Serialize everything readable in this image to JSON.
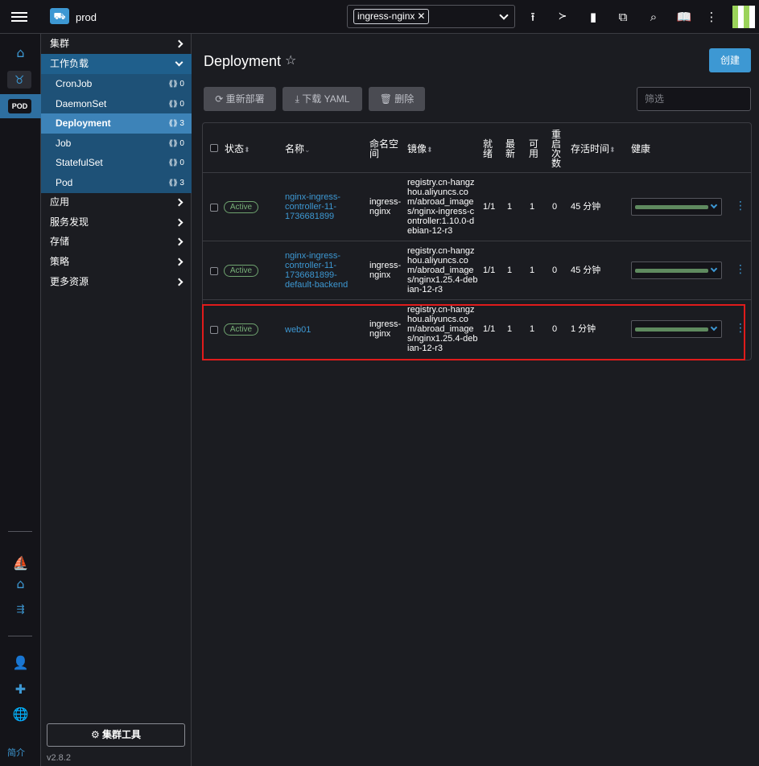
{
  "topbar": {
    "cluster_name": "prod",
    "namespace_chip": "ingress-nginx",
    "chip_remove": "✕",
    "icons": [
      "import-yaml-icon",
      "kubectl-shell-icon",
      "kubeconfig-icon",
      "copy-kubeconfig-icon",
      "search-icon",
      "docs-icon",
      "more-icon"
    ]
  },
  "rail": {
    "pod_label": "POD",
    "about": "简介"
  },
  "nav": {
    "groups": [
      {
        "label": "集群"
      },
      {
        "label": "工作负载"
      },
      {
        "label": "应用"
      },
      {
        "label": "服务发现"
      },
      {
        "label": "存储"
      },
      {
        "label": "策略"
      },
      {
        "label": "更多资源"
      }
    ],
    "workloads": [
      {
        "label": "CronJob",
        "count": "⟪⟫ 0"
      },
      {
        "label": "DaemonSet",
        "count": "⟪⟫ 0"
      },
      {
        "label": "Deployment",
        "count": "⟪⟫ 3"
      },
      {
        "label": "Job",
        "count": "⟪⟫ 0"
      },
      {
        "label": "StatefulSet",
        "count": "⟪⟫ 0"
      },
      {
        "label": "Pod",
        "count": "⟪⟫ 3"
      }
    ],
    "cluster_tools": "⚙ 集群工具",
    "version": "v2.8.2"
  },
  "main": {
    "title": "Deployment",
    "star": "☆",
    "create": "创建",
    "redeploy": "⟳ 重新部署",
    "download_yaml": "⤓ 下载 YAML",
    "delete": "🗑 删除",
    "filter_placeholder": "筛选"
  },
  "table": {
    "headers": {
      "state": "状态",
      "name": "名称",
      "namespace": "命名空间",
      "image": "镜像",
      "ready": "就绪",
      "uptodate": "最新",
      "available": "可用",
      "restarts": "重启次数",
      "age": "存活时间",
      "health": "健康",
      "sort": "⬍",
      "sort_active": "⌄"
    },
    "rows": [
      {
        "state": "Active",
        "name": "nginx-ingress-controller-11-1736681899",
        "namespace": "ingress-nginx",
        "image": "registry.cn-hangzhou.aliyuncs.com/abroad_images/nginx-ingress-controller:1.10.0-debian-12-r3",
        "ready": "1/1",
        "uptodate": "1",
        "available": "1",
        "restarts": "0",
        "age": "45 分钟"
      },
      {
        "state": "Active",
        "name": "nginx-ingress-controller-11-1736681899-default-backend",
        "namespace": "ingress-nginx",
        "image": "registry.cn-hangzhou.aliyuncs.com/abroad_images/nginx1.25.4-debian-12-r3",
        "ready": "1/1",
        "uptodate": "1",
        "available": "1",
        "restarts": "0",
        "age": "45 分钟"
      },
      {
        "state": "Active",
        "name": "web01",
        "namespace": "ingress-nginx",
        "image": "registry.cn-hangzhou.aliyuncs.com/abroad_images/nginx1.25.4-debian-12-r3",
        "ready": "1/1",
        "uptodate": "1",
        "available": "1",
        "restarts": "0",
        "age": "1 分钟"
      }
    ]
  },
  "colors": {
    "accent": "#3d98d3",
    "active_badge": "#78b078",
    "highlight": "#e01b1b"
  }
}
